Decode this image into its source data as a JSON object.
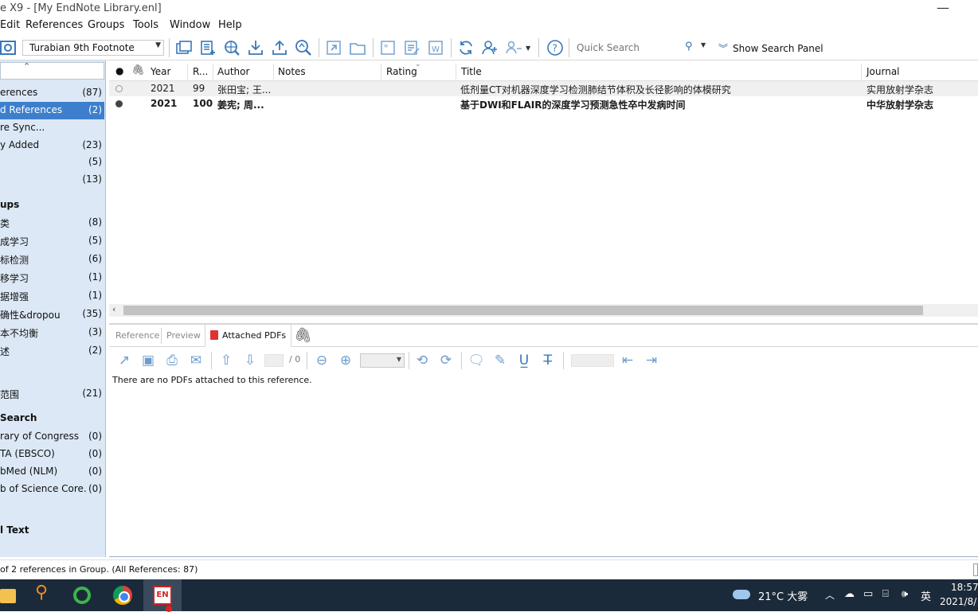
{
  "window": {
    "title": "e X9 - [My EndNote Library.enl]",
    "minimize_glyph": "—"
  },
  "menu": [
    "Edit",
    "References",
    "Groups",
    "Tools",
    "Window",
    "Help"
  ],
  "toolbar": {
    "style": "Turabian 9th Footnote",
    "search_placeholder": "Quick Search",
    "show_search_panel": "Show Search Panel"
  },
  "sidebar": {
    "items": [
      {
        "label": "erences",
        "count": "(87)"
      },
      {
        "label": "d References",
        "count": "(2)"
      },
      {
        "label": "re Sync...",
        "count": ""
      },
      {
        "label": "y Added",
        "count": "(23)"
      },
      {
        "label": "",
        "count": "(5)"
      },
      {
        "label": "",
        "count": "(13)"
      },
      {
        "label": "ups",
        "count": ""
      },
      {
        "label": "类",
        "count": "(8)"
      },
      {
        "label": "成学习",
        "count": "(5)"
      },
      {
        "label": "标检测",
        "count": "(6)"
      },
      {
        "label": "移学习",
        "count": "(1)"
      },
      {
        "label": "据增强",
        "count": "(1)"
      },
      {
        "label": "确性&dropou",
        "count": "(35)"
      },
      {
        "label": "本不均衡",
        "count": "(3)"
      },
      {
        "label": "述",
        "count": "(2)"
      },
      {
        "label": "范围",
        "count": "(21)"
      },
      {
        "label": "Search",
        "count": ""
      },
      {
        "label": "rary of Congress",
        "count": "(0)"
      },
      {
        "label": "TA (EBSCO)",
        "count": "(0)"
      },
      {
        "label": "bMed (NLM)",
        "count": "(0)"
      },
      {
        "label": "b of Science Core...",
        "count": "(0)"
      },
      {
        "label": "l Text",
        "count": ""
      }
    ]
  },
  "table": {
    "headers": [
      "Year",
      "R...",
      "Author",
      "Notes",
      "Rating",
      "Title",
      "Journal"
    ],
    "rows": [
      {
        "year": "2021",
        "r": "99",
        "author": "张田宝; 王...",
        "notes": "",
        "title": "低剂量CT对机器深度学习检测肺结节体积及长径影响的体模研究",
        "journal": "实用放射学杂志"
      },
      {
        "year": "2021",
        "r": "100",
        "author": "姜宪; 周...",
        "notes": "",
        "title": "基于DWI和FLAIR的深度学习预测急性卒中发病时间",
        "journal": "中华放射学杂志"
      }
    ]
  },
  "tabs": {
    "reference": "Reference",
    "preview": "Preview",
    "attached": "Attached PDFs"
  },
  "pdf": {
    "page_total": "/ 0",
    "empty_message": "There are no PDFs attached to this reference."
  },
  "status": "of 2 references in Group. (All References: 87)",
  "taskbar": {
    "en_label": "EN",
    "weather": "21°C 大雾",
    "ime": "英",
    "time": "18:57",
    "date": "2021/8/"
  }
}
